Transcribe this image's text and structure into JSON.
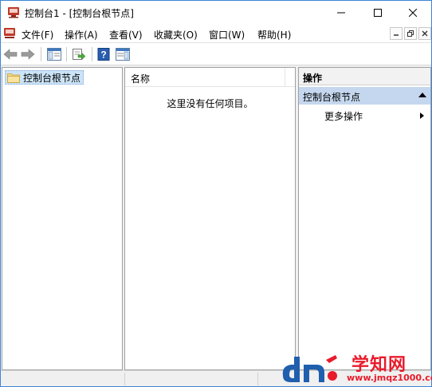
{
  "window": {
    "title": "控制台1 - [控制台根节点]"
  },
  "menubar": {
    "items": [
      "文件(F)",
      "操作(A)",
      "查看(V)",
      "收藏夹(O)",
      "窗口(W)",
      "帮助(H)"
    ]
  },
  "tree": {
    "root_label": "控制台根节点"
  },
  "list": {
    "column_name": "名称",
    "empty_message": "这里没有任何项目。"
  },
  "actions": {
    "header": "操作",
    "section_title": "控制台根节点",
    "more_actions": "更多操作"
  },
  "watermark": {
    "title": "学知网",
    "url": "www.jmqz1000.com"
  },
  "colors": {
    "window_border": "#3c86d6",
    "tree_selection": "#cce4f7",
    "actions_section": "#c5d7ee",
    "watermark_red": "#e81b2b",
    "watermark_blue": "#1f5fae"
  }
}
